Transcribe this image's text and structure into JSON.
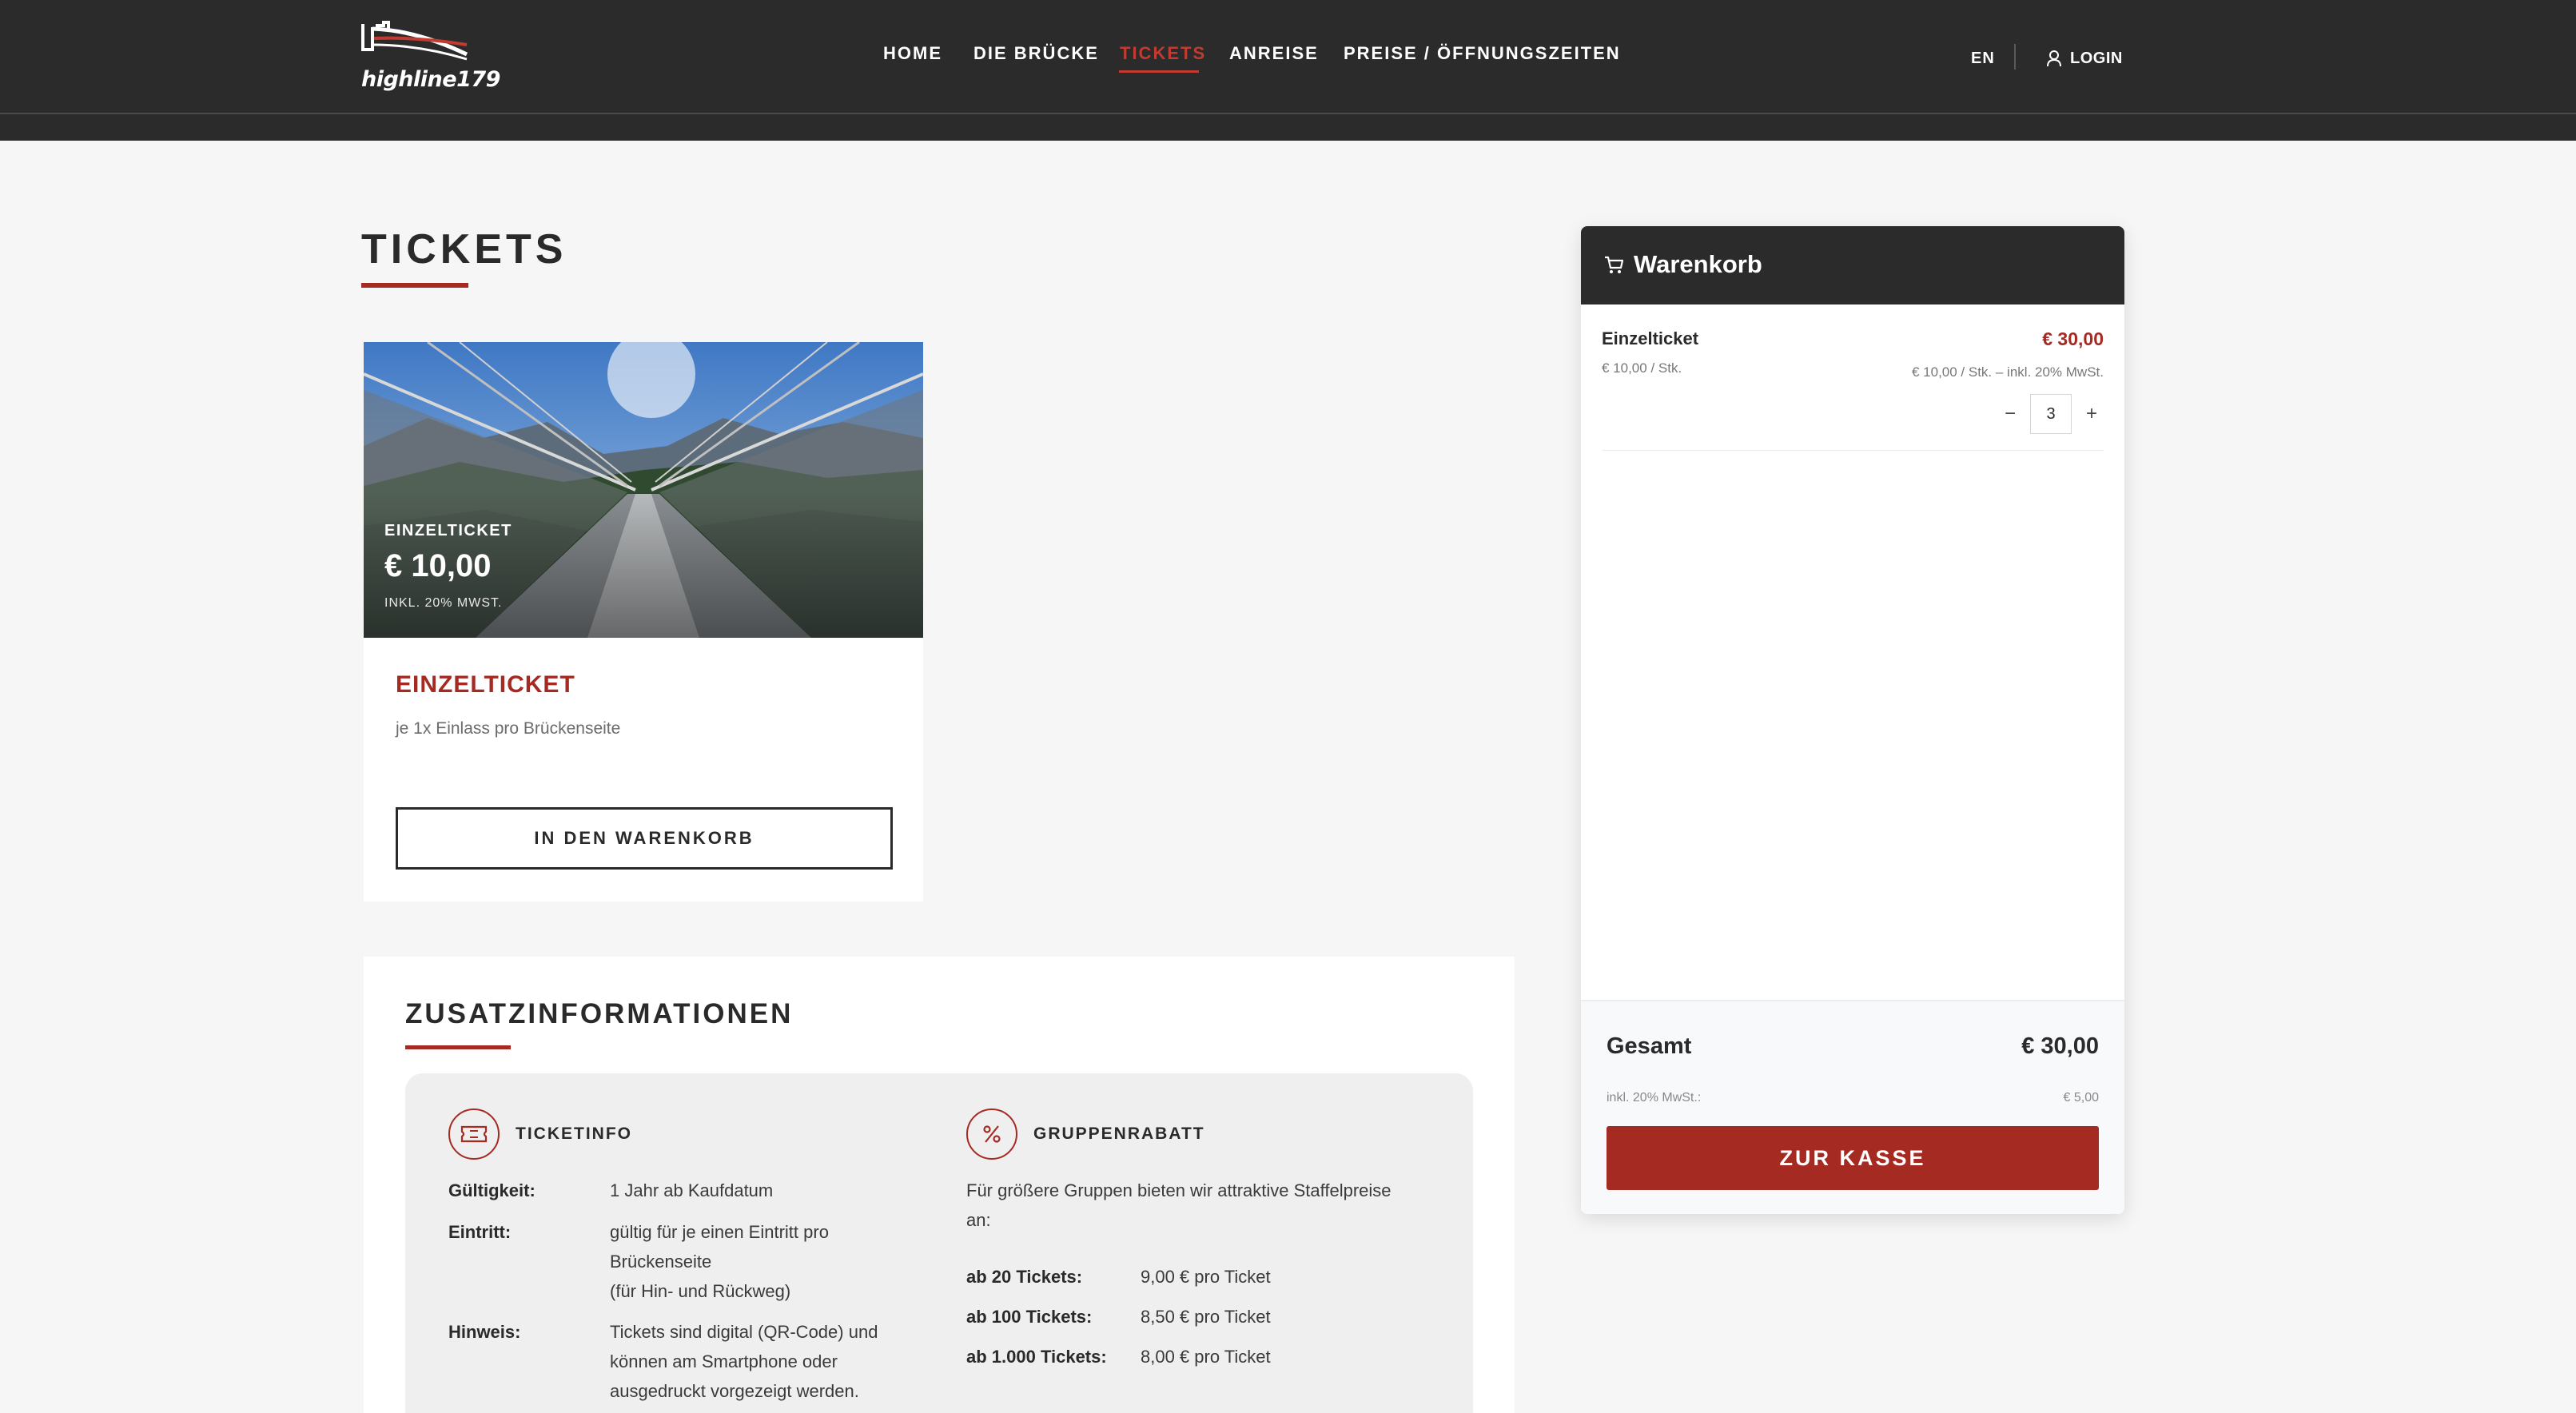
{
  "header": {
    "logo_text": "highline179",
    "nav": [
      {
        "label": "HOME"
      },
      {
        "label": "DIE BRÜCKE"
      },
      {
        "label": "TICKETS"
      },
      {
        "label": "ANREISE"
      },
      {
        "label": "PREISE / ÖFFNUNGSZEITEN"
      }
    ],
    "active_nav": "TICKETS",
    "lang": "EN",
    "login": "LOGIN"
  },
  "main": {
    "title": "TICKETS",
    "ticket": {
      "image_label": "EINZELTICKET",
      "image_price": "€ 10,00",
      "image_vat": "INKL. 20% MWST.",
      "name": "EINZELTICKET",
      "description": "je 1x Einlass pro Brückenseite",
      "add_button": "IN DEN WARENKORB"
    },
    "info": {
      "title": "ZUSATZINFORMATIONEN",
      "ticketinfo": {
        "heading": "TICKETINFO",
        "rows": [
          {
            "key": "Gültigkeit:",
            "value": "1 Jahr ab Kaufdatum"
          },
          {
            "key": "Eintritt:",
            "value_lines": [
              "gültig für je einen Eintritt pro",
              "Brückenseite",
              "(für Hin- und Rückweg)"
            ]
          },
          {
            "key": "Hinweis:",
            "value_lines": [
              "Tickets sind digital (QR-Code) und",
              "können am Smartphone oder",
              "ausgedruckt vorgezeigt werden."
            ]
          }
        ]
      },
      "gruppenrabatt": {
        "heading": "GRUPPENRABATT",
        "intro_lines": [
          "Für größere Gruppen bieten wir attraktive Staffelpreise",
          "an:"
        ],
        "tiers": [
          {
            "key": "ab 20 Tickets:",
            "value": "9,00 € pro Ticket"
          },
          {
            "key": "ab 100 Tickets:",
            "value": "8,50 € pro Ticket"
          },
          {
            "key": "ab 1.000 Tickets:",
            "value": "8,00 € pro Ticket"
          }
        ]
      }
    }
  },
  "cart": {
    "title": "Warenkorb",
    "item": {
      "name": "Einzelticket",
      "total": "€ 30,00",
      "unit": "€ 10,00 / Stk.",
      "detail": "€ 10,00 / Stk. – inkl. 20% MwSt.",
      "quantity": "3",
      "minus": "−",
      "plus": "+"
    },
    "total_label": "Gesamt",
    "total_value": "€ 30,00",
    "vat_label": "inkl. 20% MwSt.:",
    "vat_value": "€ 5,00",
    "checkout": "ZUR KASSE"
  },
  "colors": {
    "accent": "#a52a22",
    "header_bg": "#2b2b2b",
    "page_bg": "#f6f6f6"
  }
}
